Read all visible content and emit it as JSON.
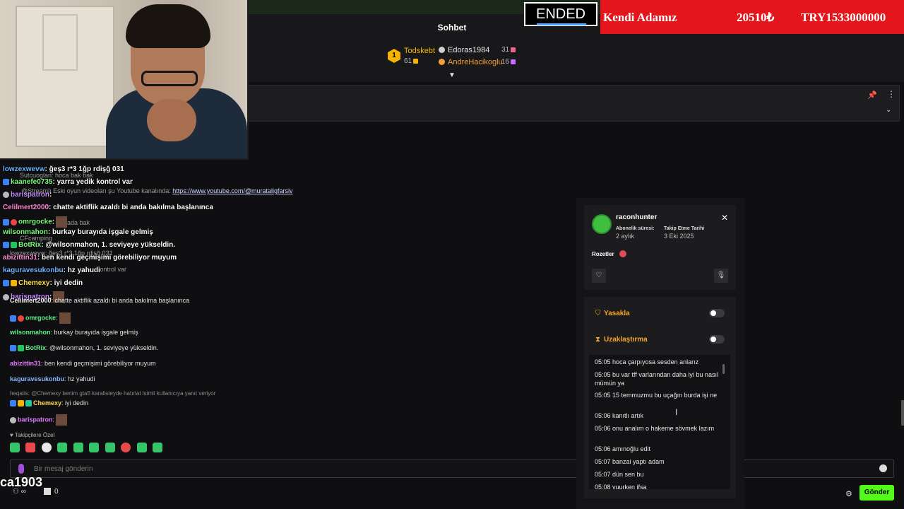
{
  "header": {
    "chat_title": "Sohbet",
    "ended_label": "ENDED",
    "ticker": [
      "Kendi Adamız",
      "20510₺",
      "TRY1533000000"
    ]
  },
  "leaderboard": {
    "rank": "1",
    "first": {
      "name": "Todskebt",
      "points": "61"
    },
    "second": {
      "name": "Edoras1984",
      "points": "31"
    },
    "third": {
      "name": "AndreHacikoglu",
      "points": "16"
    }
  },
  "overlay_chat": [
    {
      "user": "lowzexwevw",
      "text": ": ğeş3 r*3 1ğp rdişğ 031"
    },
    {
      "user": "kaanefe0735",
      "text": ": yarra yedik kontrol var"
    },
    {
      "user": "barispatron",
      "text": ":"
    },
    {
      "user": "Celilmert2000",
      "text": ": chatte aktiflik azaldı bi anda bakılma başlanınca"
    },
    {
      "user": "omrgocke",
      "text": ":"
    },
    {
      "user": "wilsonmahon",
      "text": ": burkay burayıda işgale gelmiş"
    },
    {
      "user": "BotRix",
      "text": ": @wilsonmahon, 1. seviyeye yükseldin."
    },
    {
      "user": "abizittin31",
      "text": ": ben kendi geçmişimi görebiliyor muyum"
    },
    {
      "user": "kaguravesukonbu",
      "text": ": hz yahudi"
    },
    {
      "user": "Chemexy",
      "text": ": iyi dedin"
    },
    {
      "user": "barispatron",
      "text": ":"
    }
  ],
  "overlay_ghosts": [
    "Sutcuoglan: hoca bak bak",
    "@Streamlı Eski oyun videoları şu Youtube kanalında:",
    "https://www.youtube.com/@murataligfarsiv",
    "ada bak",
    "CFcamping",
    "lowzexwevw: ğeş3 r*3 1ğp rdişğ 031",
    "kontrol var"
  ],
  "chat": [
    {
      "user": "Celilmert2000",
      "text": ": chatte aktiflik azaldı bi anda bakılma başlanınca"
    },
    {
      "user": "omrgocke",
      "text": ":"
    },
    {
      "user": "wilsonmahon",
      "text": ": burkay burayıda işgale gelmiş"
    },
    {
      "user": "BotRix",
      "text": ": @wilsonmahon, 1. seviyeye yükseldin."
    },
    {
      "user": "abizittin31",
      "text": ": ben kendi geçmişimi görebiliyor muyum"
    },
    {
      "user": "kaguravesukonbu",
      "text": ": hz yahudi"
    },
    {
      "user": "Chemexy",
      "text": ": iyi dedin"
    },
    {
      "user": "barispatron",
      "text": ":"
    }
  ],
  "reply_hint": "heqatis: @Chemexy benim gta5 karalisteyde hatırlat isimli kullanıcıya yanıt veriyor",
  "followers_label": "Takipçilere Özel",
  "composer": {
    "placeholder": "Bir mesaj gönderin",
    "send_label": "Gönder"
  },
  "handle_overlay": "ca1903",
  "viewer_count": "0",
  "user_card": {
    "username": "raconhunter",
    "sub_label": "Abonelik süresi:",
    "sub_value": "2 aylık",
    "follow_label": "Takip Etme Tarihi",
    "follow_value": "3 Eki 2025",
    "badges_label": "Rozetler",
    "ban_label": "Yasakla",
    "timeout_label": "Uzaklaştırma",
    "history": [
      "05:05 hoca çarpıyosa sesden anlarız",
      "05:05 bu var tff varlarından daha iyi bu nasıl mümün ya",
      "05:05 15 temmuzmu bu uçağın burda işi ne",
      "05:06 kanıtlı artık",
      "05:06 onu analım o hakeme sövmek lazım",
      "05:06 amınoğlu edit",
      "05:07 banzai yaptı adam",
      "05:07 dün sen bu",
      "05:08 yuurken ifsa"
    ]
  }
}
